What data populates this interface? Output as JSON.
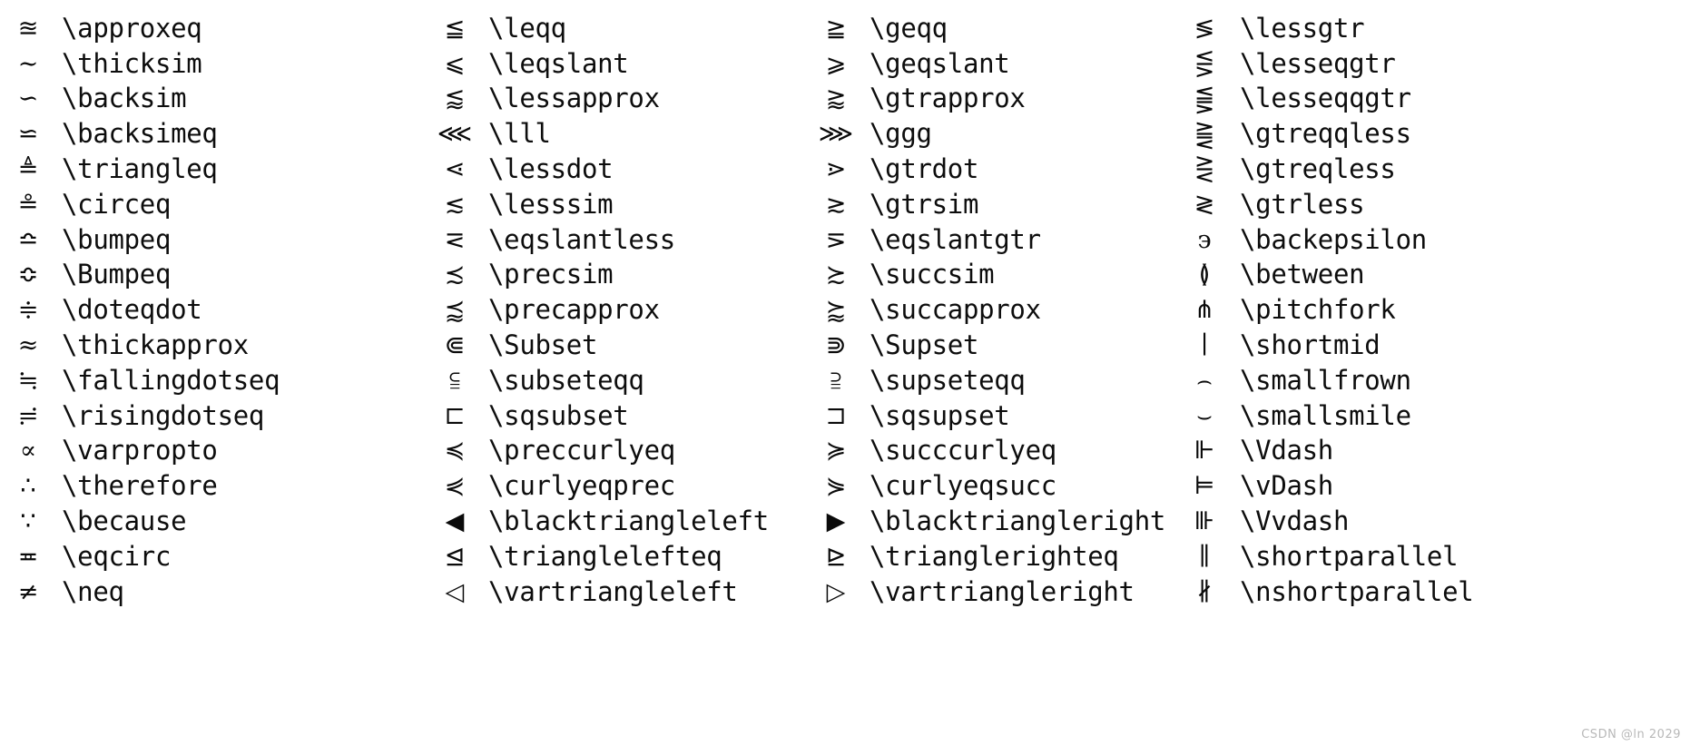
{
  "page": {
    "kind": "latex-symbol-reference-table",
    "rows": 17,
    "columns": 4,
    "background_color": "#ffffff",
    "text_color": "#0a0a0a"
  },
  "watermark": {
    "text": "CSDN @ln 2029",
    "color": "#b8b8b8"
  },
  "columns": [
    {
      "index": 1,
      "entries": [
        {
          "glyph": "≊",
          "command": "\\approxeq"
        },
        {
          "glyph": "∼",
          "command": "\\thicksim"
        },
        {
          "glyph": "∽",
          "command": "\\backsim"
        },
        {
          "glyph": "⋍",
          "command": "\\backsimeq"
        },
        {
          "glyph": "≜",
          "command": "\\triangleq"
        },
        {
          "glyph": "≗",
          "command": "\\circeq"
        },
        {
          "glyph": "≏",
          "command": "\\bumpeq"
        },
        {
          "glyph": "≎",
          "command": "\\Bumpeq"
        },
        {
          "glyph": "≑",
          "command": "\\doteqdot"
        },
        {
          "glyph": "≈",
          "command": "\\thickapprox"
        },
        {
          "glyph": "≒",
          "command": "\\fallingdotseq"
        },
        {
          "glyph": "≓",
          "command": "\\risingdotseq"
        },
        {
          "glyph": "∝",
          "command": "\\varpropto"
        },
        {
          "glyph": "∴",
          "command": "\\therefore"
        },
        {
          "glyph": "∵",
          "command": "\\because"
        },
        {
          "glyph": "≖",
          "command": "\\eqcirc"
        },
        {
          "glyph": "≠",
          "command": "\\neq"
        }
      ]
    },
    {
      "index": 2,
      "entries": [
        {
          "glyph": "≦",
          "command": "\\leqq"
        },
        {
          "glyph": "⩽",
          "command": "\\leqslant"
        },
        {
          "glyph": "⪅",
          "command": "\\lessapprox"
        },
        {
          "glyph": "⋘",
          "command": "\\lll"
        },
        {
          "glyph": "⋖",
          "command": "\\lessdot"
        },
        {
          "glyph": "≲",
          "command": "\\lesssim"
        },
        {
          "glyph": "⋜",
          "command": "\\eqslantless"
        },
        {
          "glyph": "≾",
          "command": "\\precsim"
        },
        {
          "glyph": "⪷",
          "command": "\\precapprox"
        },
        {
          "glyph": "⋐",
          "command": "\\Subset"
        },
        {
          "glyph": "⫅",
          "command": "\\subseteqq"
        },
        {
          "glyph": "⊏",
          "command": "\\sqsubset"
        },
        {
          "glyph": "≼",
          "command": "\\preccurlyeq"
        },
        {
          "glyph": "⋞",
          "command": "\\curlyeqprec"
        },
        {
          "glyph": "◀",
          "command": "\\blacktriangleleft"
        },
        {
          "glyph": "⊴",
          "command": "\\trianglelefteq"
        },
        {
          "glyph": "◁",
          "command": "\\vartriangleleft"
        }
      ]
    },
    {
      "index": 3,
      "entries": [
        {
          "glyph": "≧",
          "command": "\\geqq"
        },
        {
          "glyph": "⩾",
          "command": "\\geqslant"
        },
        {
          "glyph": "⪆",
          "command": "\\gtrapprox"
        },
        {
          "glyph": "⋙",
          "command": "\\ggg"
        },
        {
          "glyph": "⋗",
          "command": "\\gtrdot"
        },
        {
          "glyph": "≳",
          "command": "\\gtrsim"
        },
        {
          "glyph": "⋝",
          "command": "\\eqslantgtr"
        },
        {
          "glyph": "≿",
          "command": "\\succsim"
        },
        {
          "glyph": "⪸",
          "command": "\\succapprox"
        },
        {
          "glyph": "⋑",
          "command": "\\Supset"
        },
        {
          "glyph": "⫆",
          "command": "\\supseteqq"
        },
        {
          "glyph": "⊐",
          "command": "\\sqsupset"
        },
        {
          "glyph": "≽",
          "command": "\\succcurlyeq"
        },
        {
          "glyph": "⋟",
          "command": "\\curlyeqsucc"
        },
        {
          "glyph": "▶",
          "command": "\\blacktriangleright"
        },
        {
          "glyph": "⊵",
          "command": "\\trianglerighteq"
        },
        {
          "glyph": "▷",
          "command": "\\vartriangleright"
        }
      ]
    },
    {
      "index": 4,
      "entries": [
        {
          "glyph": "≶",
          "command": "\\lessgtr"
        },
        {
          "glyph": "⋚",
          "command": "\\lesseqgtr"
        },
        {
          "glyph": "⪋",
          "command": "\\lesseqqgtr"
        },
        {
          "glyph": "⪌",
          "command": "\\gtreqqless"
        },
        {
          "glyph": "⋛",
          "command": "\\gtreqless"
        },
        {
          "glyph": "≷",
          "command": "\\gtrless"
        },
        {
          "glyph": "϶",
          "command": "\\backepsilon"
        },
        {
          "glyph": "≬",
          "command": "\\between"
        },
        {
          "glyph": "⋔",
          "command": "\\pitchfork"
        },
        {
          "glyph": "∣",
          "command": "\\shortmid"
        },
        {
          "glyph": "⌢",
          "command": "\\smallfrown"
        },
        {
          "glyph": "⌣",
          "command": "\\smallsmile"
        },
        {
          "glyph": "⊩",
          "command": "\\Vdash"
        },
        {
          "glyph": "⊨",
          "command": "\\vDash"
        },
        {
          "glyph": "⊪",
          "command": "\\Vvdash"
        },
        {
          "glyph": "∥",
          "command": "\\shortparallel"
        },
        {
          "glyph": "∦",
          "command": "\\nshortparallel"
        }
      ]
    }
  ]
}
